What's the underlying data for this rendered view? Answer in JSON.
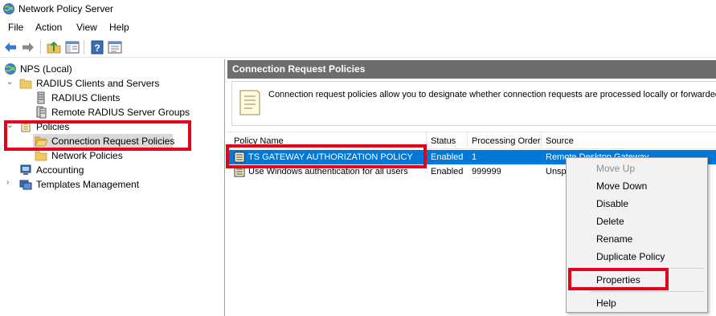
{
  "window": {
    "title": "Network Policy Server"
  },
  "menu": [
    "File",
    "Action",
    "View",
    "Help"
  ],
  "tree": {
    "root": "NPS (Local)",
    "radius_group": "RADIUS Clients and Servers",
    "radius_clients": "RADIUS Clients",
    "remote_groups": "Remote RADIUS Server Groups",
    "policies": "Policies",
    "conn_req": "Connection Request Policies",
    "network_policies": "Network Policies",
    "accounting": "Accounting",
    "templates": "Templates Management"
  },
  "pane": {
    "header": "Connection Request Policies",
    "description": "Connection request policies allow you to designate whether connection requests are processed locally or forwarded to r"
  },
  "table": {
    "columns": [
      "Policy Name",
      "Status",
      "Processing Order",
      "Source"
    ],
    "rows": [
      {
        "name": "TS GATEWAY AUTHORIZATION POLICY",
        "status": "Enabled",
        "order": "1",
        "source": "Remote Desktop Gateway"
      },
      {
        "name": "Use Windows authentication for all users",
        "status": "Enabled",
        "order": "999999",
        "source": "Unspecified"
      }
    ]
  },
  "context_menu": {
    "move_up": "Move Up",
    "move_down": "Move Down",
    "disable": "Disable",
    "delete": "Delete",
    "rename": "Rename",
    "duplicate": "Duplicate Policy",
    "properties": "Properties",
    "help": "Help"
  },
  "colors": {
    "selection": "#0078d7",
    "highlight": "#e3001b",
    "pane_header": "#6d6d6d"
  }
}
